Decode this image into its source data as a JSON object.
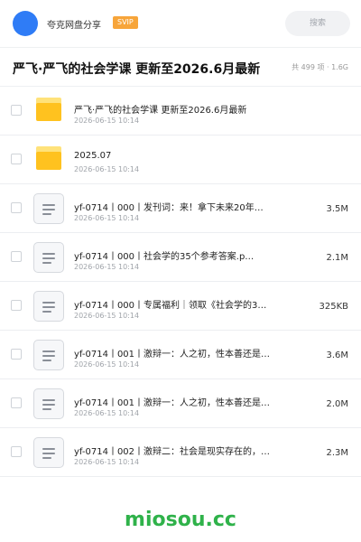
{
  "header": {
    "username": "夸克网盘分享",
    "badge": "SVIP",
    "search_placeholder": "搜索",
    "avatar_color": "#2f7cf6"
  },
  "share": {
    "title": "严飞·严飞的社会学课 更新至2026.6月最新",
    "meta": "共 499 项 · 1.6G"
  },
  "files": [
    {
      "type": "folder",
      "name": "严飞·严飞的社会学课 更新至2026.6月最新",
      "date": "2026-06-15 10:14",
      "size": ""
    },
    {
      "type": "folder",
      "name": "2025.07",
      "date": "2026-06-15 10:14",
      "size": ""
    },
    {
      "type": "doc",
      "name": "yf-0714丨000丨发刊词：来！拿下未来20年…",
      "date": "2026-06-15 10:14",
      "size": "3.5M"
    },
    {
      "type": "doc",
      "name": "yf-0714丨000丨社会学的35个参考答案.p…",
      "date": "2026-06-15 10:14",
      "size": "2.1M"
    },
    {
      "type": "doc",
      "name": "yf-0714丨000丨专属福利｜领取《社会学的3…",
      "date": "2026-06-15 10:14",
      "size": "325KB"
    },
    {
      "type": "doc",
      "name": "yf-0714丨001丨激辩一：人之初，性本善还是…",
      "date": "2026-06-15 10:14",
      "size": "3.6M"
    },
    {
      "type": "doc",
      "name": "yf-0714丨001丨激辩一：人之初，性本善还是…",
      "date": "2026-06-15 10:14",
      "size": "2.0M"
    },
    {
      "type": "doc",
      "name": "yf-0714丨002丨激辩二：社会是现实存在的，…",
      "date": "2026-06-15 10:14",
      "size": "2.3M"
    }
  ],
  "watermark": "miosou.cc",
  "colors": {
    "badge": "#f7a53a",
    "folder": "#ffc21f",
    "watermark": "#2fb24a"
  }
}
